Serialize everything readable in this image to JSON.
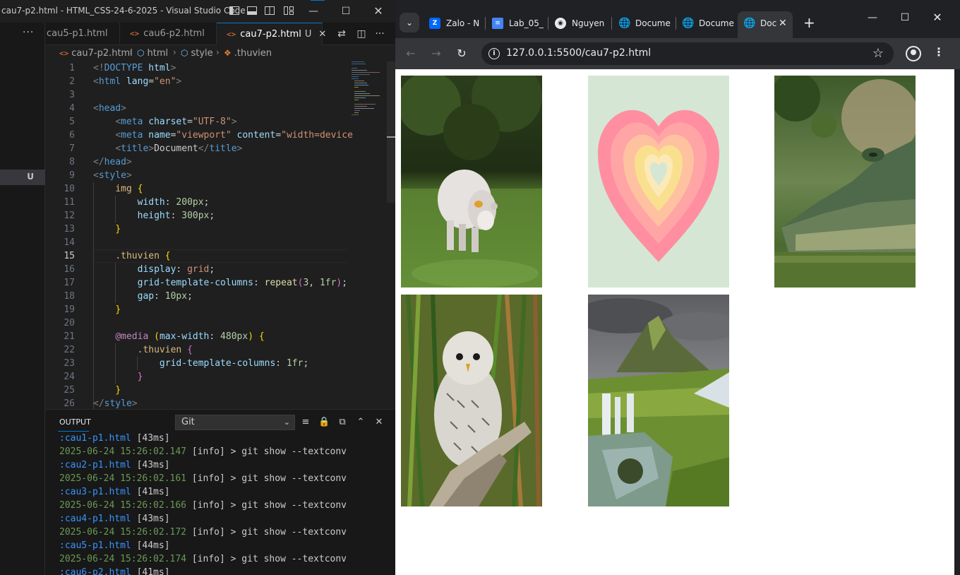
{
  "vscode": {
    "window_title": "cau7-p2.html - HTML_CSS-24-6-2025 - Visual Studio Code",
    "tabs": [
      {
        "label": "cau5-p1.html"
      },
      {
        "label": "cau6-p2.html"
      },
      {
        "label": "cau7-p2.html",
        "status": "U",
        "active": true
      }
    ],
    "sidebar": {
      "status": "U"
    },
    "breadcrumb": [
      "cau7-p2.html",
      "html",
      "style",
      ".thuvien"
    ],
    "editor": {
      "current_line": 15,
      "line_numbers": [
        "1",
        "2",
        "3",
        "4",
        "5",
        "6",
        "7",
        "8",
        "9",
        "10",
        "11",
        "12",
        "13",
        "14",
        "15",
        "16",
        "17",
        "18",
        "19",
        "20",
        "21",
        "22",
        "23",
        "24",
        "25",
        "26"
      ]
    },
    "panel": {
      "tab": "OUTPUT",
      "channel": "Git",
      "lines": [
        {
          "file": ":cau1-p1.html",
          "ms": "[43ms]"
        },
        {
          "date": "2025-06-24 15:26:02.147",
          "level": "[info]",
          "cmd": "> git show --textconv"
        },
        {
          "file": ":cau2-p1.html",
          "ms": "[43ms]"
        },
        {
          "date": "2025-06-24 15:26:02.161",
          "level": "[info]",
          "cmd": "> git show --textconv"
        },
        {
          "file": ":cau3-p1.html",
          "ms": "[41ms]"
        },
        {
          "date": "2025-06-24 15:26:02.166",
          "level": "[info]",
          "cmd": "> git show --textconv"
        },
        {
          "file": ":cau4-p1.html",
          "ms": "[43ms]"
        },
        {
          "date": "2025-06-24 15:26:02.172",
          "level": "[info]",
          "cmd": "> git show --textconv"
        },
        {
          "file": ":cau5-p1.html",
          "ms": "[44ms]"
        },
        {
          "date": "2025-06-24 15:26:02.174",
          "level": "[info]",
          "cmd": "> git show --textconv"
        },
        {
          "file": ":cau6-p2.html",
          "ms": "[41ms]"
        }
      ]
    }
  },
  "chrome": {
    "tabs": [
      {
        "label": "Zalo - N",
        "icon": "zalo-icon"
      },
      {
        "label": "Lab_05_",
        "icon": "docs-icon"
      },
      {
        "label": "Nguyen",
        "icon": "github-icon"
      },
      {
        "label": "Docume",
        "icon": "globe-icon"
      },
      {
        "label": "Docume",
        "icon": "globe-icon"
      },
      {
        "label": "Doc",
        "icon": "globe-icon",
        "active": true
      }
    ],
    "url": "127.0.0.1:5500/cau7-p2.html",
    "gallery": [
      {
        "alt": "cow-photo"
      },
      {
        "alt": "heart-photo"
      },
      {
        "alt": "crocodile-photo"
      },
      {
        "alt": "owl-photo"
      },
      {
        "alt": "mountain-waterfall-photo"
      }
    ]
  }
}
